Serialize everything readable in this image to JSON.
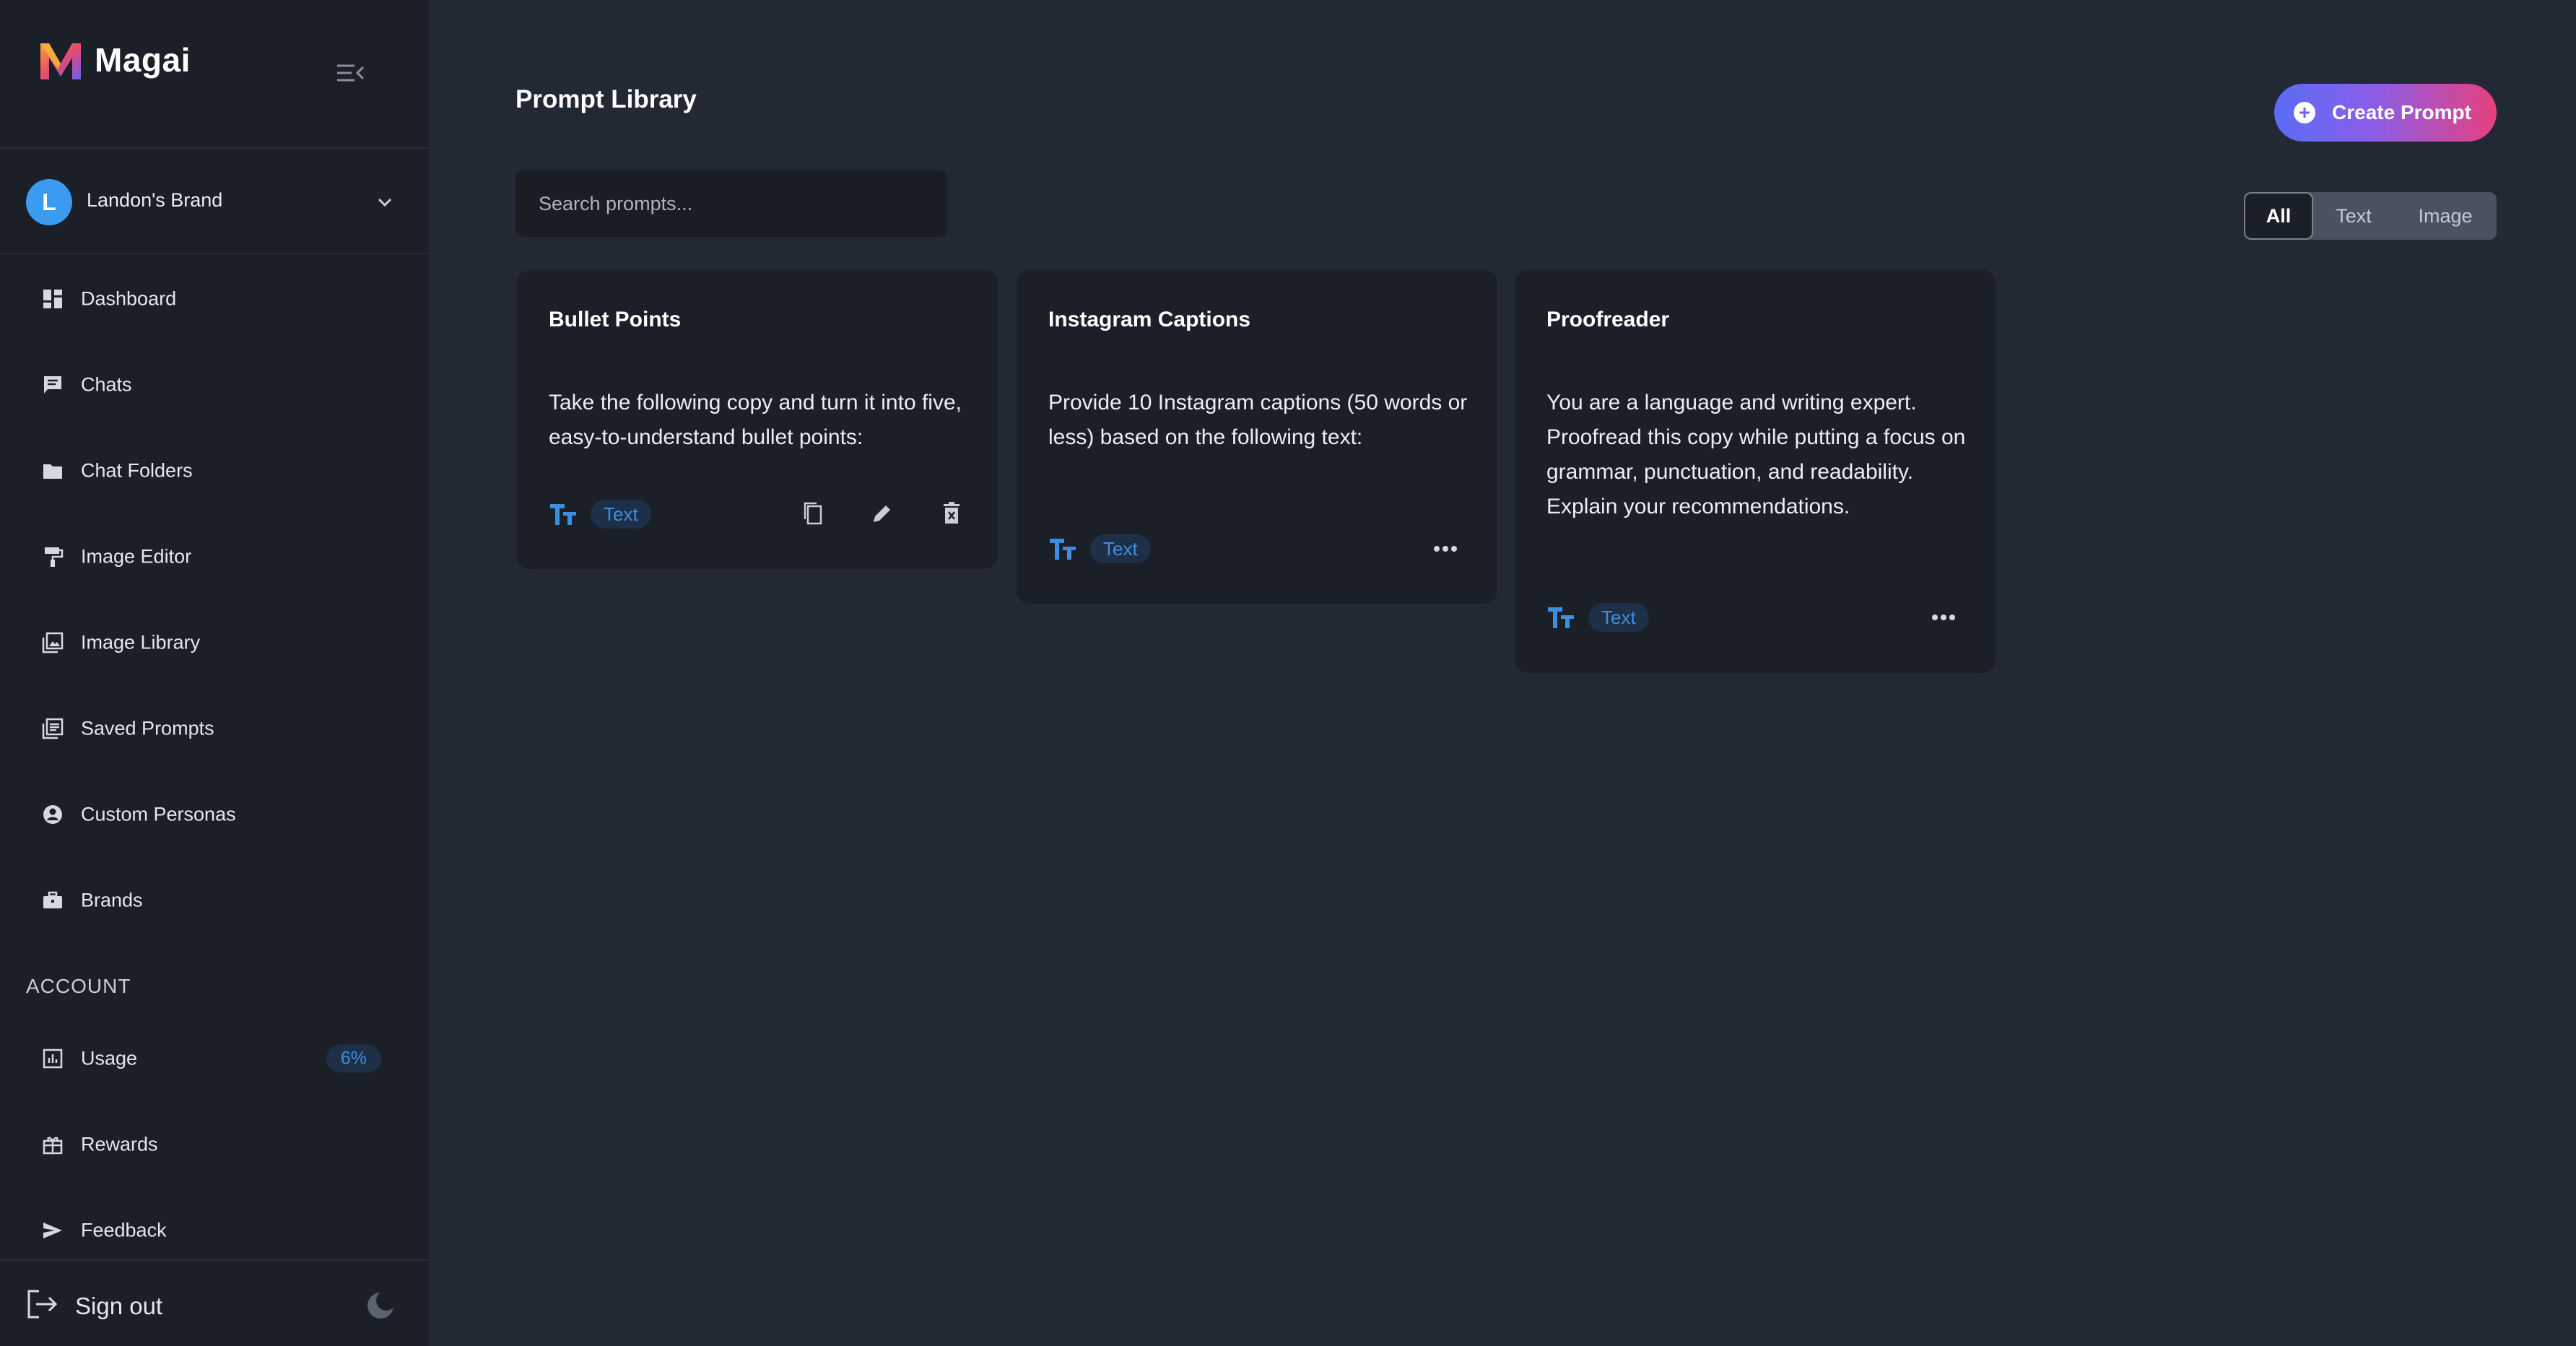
{
  "app": {
    "name": "Magai"
  },
  "brand": {
    "initial": "L",
    "name": "Landon's Brand"
  },
  "nav": {
    "items": [
      {
        "label": "Dashboard",
        "icon": "dashboard-icon"
      },
      {
        "label": "Chats",
        "icon": "chat-icon"
      },
      {
        "label": "Chat Folders",
        "icon": "folder-icon"
      },
      {
        "label": "Image Editor",
        "icon": "paint-roller-icon"
      },
      {
        "label": "Image Library",
        "icon": "image-library-icon"
      },
      {
        "label": "Saved Prompts",
        "icon": "saved-prompts-icon"
      },
      {
        "label": "Custom Personas",
        "icon": "persona-icon"
      },
      {
        "label": "Brands",
        "icon": "briefcase-icon"
      }
    ]
  },
  "account": {
    "section_label": "ACCOUNT",
    "items": [
      {
        "label": "Usage",
        "icon": "usage-chart-icon",
        "badge": "6%"
      },
      {
        "label": "Rewards",
        "icon": "gift-icon"
      },
      {
        "label": "Feedback",
        "icon": "send-icon"
      }
    ]
  },
  "footer": {
    "signout_label": "Sign out"
  },
  "main": {
    "title": "Prompt Library",
    "create_label": "Create Prompt",
    "search_placeholder": "Search prompts...",
    "filters": [
      "All",
      "Text",
      "Image"
    ],
    "active_filter": "All"
  },
  "cards": [
    {
      "title": "Bullet Points",
      "body": "Take the following copy and turn it into five, easy-to-understand bullet points:",
      "type": "Text"
    },
    {
      "title": "Instagram Captions",
      "body": "Provide 10 Instagram captions (50 words or less) based on the following text:",
      "type": "Text"
    },
    {
      "title": "Proofreader",
      "body": "You are a language and writing expert. Proofread this copy while putting a focus on grammar, punctuation, and readability. Explain your recommendations.",
      "type": "Text"
    }
  ],
  "colors": {
    "accent_blue": "#3d8ee0",
    "badge_bg": "#1e3047",
    "sidebar_bg": "#1b1f27",
    "main_bg": "#222834",
    "gradient_start": "#5b6cf5",
    "gradient_end": "#e7407e"
  }
}
